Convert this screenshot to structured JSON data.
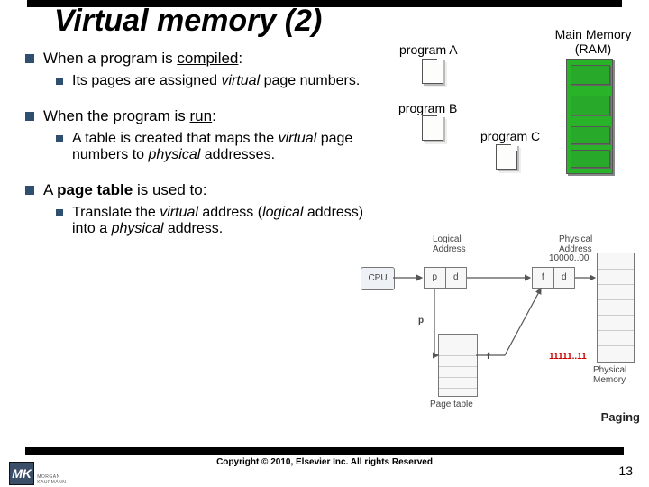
{
  "title": "Virtual memory (2)",
  "bullets": {
    "b1": "When a program is ",
    "b1_u": "compiled",
    "b1_tail": ":",
    "b1_1a": "Its pages are assigned ",
    "b1_1b": "virtual",
    "b1_1c": " page numbers.",
    "b2": "When the program is ",
    "b2_u": "run",
    "b2_tail": ":",
    "b2_1a": "A table is created that maps the ",
    "b2_1b": "virtual",
    "b2_1c": " page numbers to ",
    "b2_1d": "physical",
    "b2_1e": " addresses.",
    "b3a": "A ",
    "b3b": "page table",
    "b3c": " is used to:",
    "b3_1a": "Translate the ",
    "b3_1b": "virtual",
    "b3_1c": " address (",
    "b3_1d": "logical",
    "b3_1e": " address) into a ",
    "b3_1f": "physical",
    "b3_1g": " address."
  },
  "diagram_top": {
    "program_a": "program A",
    "program_b": "program B",
    "program_c": "program C",
    "main_memory_l1": "Main Memory",
    "main_memory_l2": "(RAM)"
  },
  "paging": {
    "logical": "Logical",
    "address": "Address",
    "physical": "Physical",
    "cpu": "CPU",
    "p": "p",
    "d": "d",
    "f": "f",
    "addr_hi": "10000..00",
    "addr_lo": "11111..11",
    "phys_mem_l1": "Physical",
    "phys_mem_l2": "Memory",
    "page_table": "Page table",
    "caption": "Paging"
  },
  "footer": {
    "copyright": "Copyright © 2010, Elsevier Inc. All rights Reserved",
    "page": "13",
    "logo": "MK",
    "publisher": "MORGAN KAUFMANN"
  }
}
